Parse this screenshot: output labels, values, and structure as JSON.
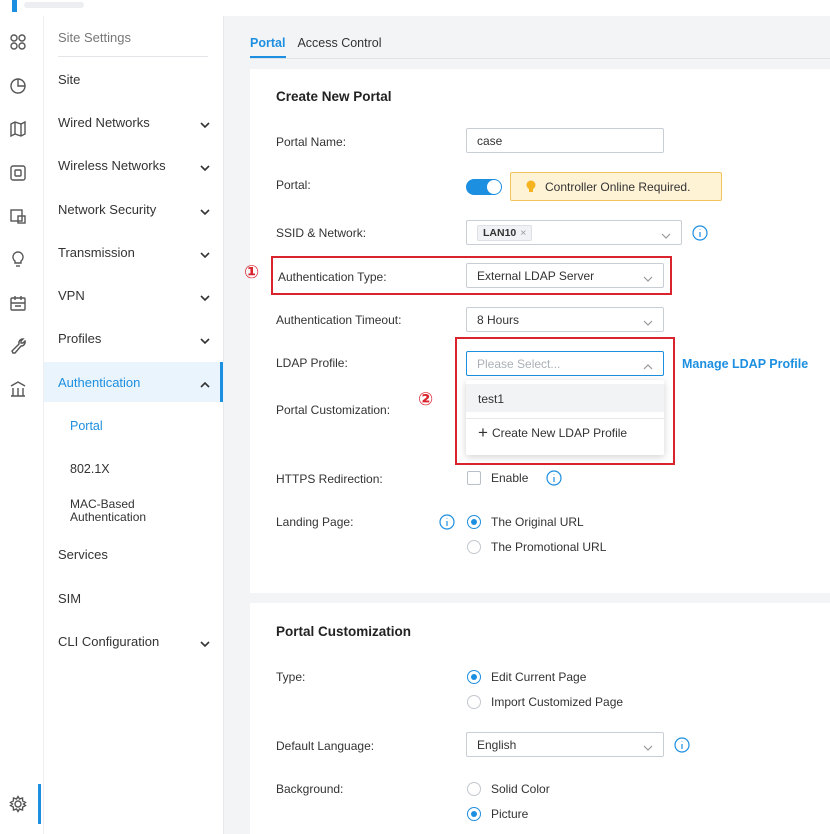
{
  "sidebar": {
    "header": "Site Settings",
    "items": [
      {
        "label": "Site"
      },
      {
        "label": "Wired Networks"
      },
      {
        "label": "Wireless Networks"
      },
      {
        "label": "Network Security"
      },
      {
        "label": "Transmission"
      },
      {
        "label": "VPN"
      },
      {
        "label": "Profiles"
      },
      {
        "label": "Authentication"
      },
      {
        "label": "Services"
      },
      {
        "label": "SIM"
      },
      {
        "label": "CLI Configuration"
      }
    ],
    "auth_sub": {
      "portal": "Portal",
      "dot1x": "802.1X",
      "mac_line1": "MAC-Based",
      "mac_line2": "Authentication"
    }
  },
  "tabs": [
    "Portal",
    "Access Control"
  ],
  "form": {
    "section_title": "Create New Portal",
    "portal_name_label": "Portal Name:",
    "portal_name_value": "case",
    "portal_label": "Portal:",
    "portal_enabled": true,
    "warning": "Controller Online Required.",
    "ssid_label": "SSID & Network:",
    "ssid_tag": "LAN10",
    "ssid_tag_remove": "×",
    "auth_type_label": "Authentication Type:",
    "auth_type_value": "External LDAP Server",
    "auth_timeout_label": "Authentication Timeout:",
    "auth_timeout_value": "8 Hours",
    "ldap_label": "LDAP Profile:",
    "ldap_placeholder": "Please Select...",
    "manage_ldap": "Manage LDAP Profile",
    "ldap_options": [
      "test1"
    ],
    "create_ldap": "Create New LDAP Profile",
    "portal_custom_label": "Portal Customization:",
    "https_label": "HTTPS Redirection:",
    "https_option": "Enable",
    "landing_label": "Landing Page:",
    "landing_options": [
      "The Original URL",
      "The Promotional URL"
    ],
    "landing_selected": "The Original URL"
  },
  "customization": {
    "section_title": "Portal Customization",
    "type_label": "Type:",
    "type_options": [
      "Edit Current Page",
      "Import Customized Page"
    ],
    "type_selected": "Edit Current Page",
    "lang_label": "Default Language:",
    "lang_value": "English",
    "bg_label": "Background:",
    "bg_options": [
      "Solid Color",
      "Picture"
    ],
    "bg_selected": "Picture"
  },
  "annotations": [
    "①",
    "②"
  ],
  "colors": {
    "accent": "#1d8fe0",
    "highlight_box": "#d9232d",
    "warning_bg": "#fff3d6"
  },
  "icons": [
    "dashboard-icon",
    "statistics-icon",
    "map-icon",
    "devices-icon",
    "clients-icon",
    "insight-icon",
    "logs-icon",
    "tools-icon",
    "reports-icon",
    "settings-icon"
  ]
}
